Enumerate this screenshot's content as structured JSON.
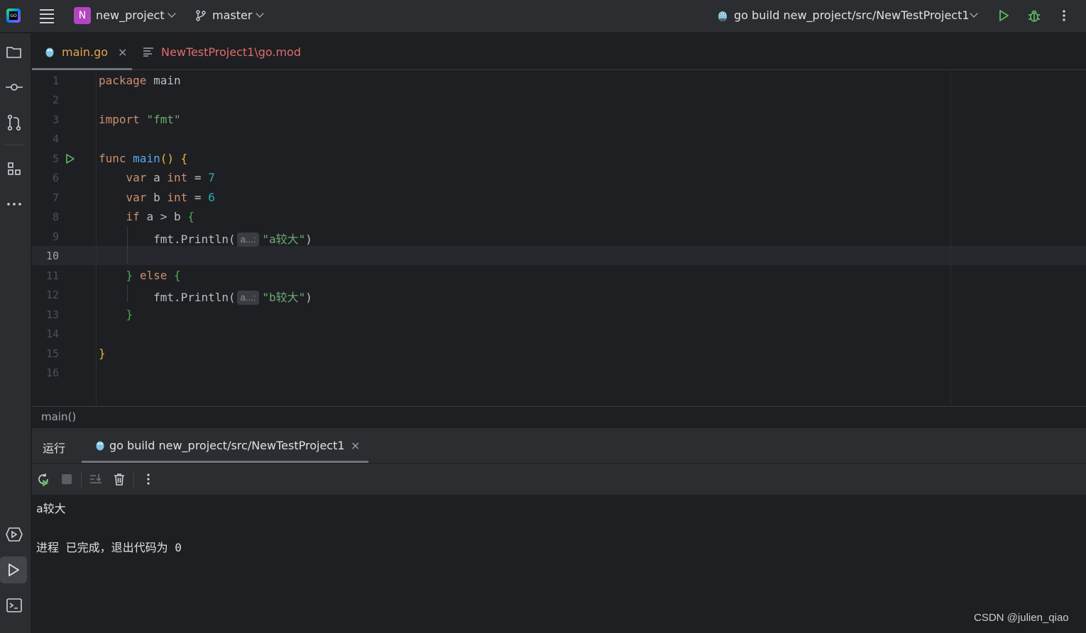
{
  "titlebar": {
    "project_badge": "N",
    "project_name": "new_project",
    "branch": "master",
    "run_config": "go build new_project/src/NewTestProject1"
  },
  "tabs": [
    {
      "label": "main.go",
      "close": "×",
      "active": true
    },
    {
      "label": "NewTestProject1\\go.mod",
      "active": false
    }
  ],
  "editor": {
    "line_numbers": [
      "1",
      "2",
      "3",
      "4",
      "5",
      "6",
      "7",
      "8",
      "9",
      "10",
      "11",
      "12",
      "13",
      "14",
      "15",
      "16"
    ],
    "current_line": "10",
    "tokens": {
      "l1_kw": "package",
      "l1_name": "main",
      "l3_kw": "import",
      "l3_str": "\"fmt\"",
      "l5_kw": "func",
      "l5_fn": "main",
      "l5_parens": "()",
      "l5_brace": "{",
      "l6_kw": "var",
      "l6_name": "a",
      "l6_type": "int",
      "l6_eq": "=",
      "l6_num": "7",
      "l7_kw": "var",
      "l7_name": "b",
      "l7_type": "int",
      "l7_eq": "=",
      "l7_num": "6",
      "l8_kw": "if",
      "l8_cond": "a > b",
      "l8_brace": "{",
      "l9_call": "fmt.Println(",
      "l9_hint": "a...:",
      "l9_str": "\"a较大\"",
      "l9_close": ")",
      "l11_close": "}",
      "l11_kw": "else",
      "l11_brace": "{",
      "l12_call": "fmt.Println(",
      "l12_hint": "a...:",
      "l12_str": "\"b较大\"",
      "l12_close": ")",
      "l13_brace": "}",
      "l15_brace": "}"
    }
  },
  "breadcrumb": "main()",
  "run_panel": {
    "title": "运行",
    "tab_label": "go build new_project/src/NewTestProject1",
    "tab_close": "×",
    "output": [
      "a较大",
      "",
      "进程 已完成，退出代码为 0"
    ]
  },
  "watermark": "CSDN @julien_qiao",
  "colors": {
    "background": "#1e1f22",
    "panel": "#2b2d30",
    "keyword": "#cf8e6d",
    "function": "#56a8f5",
    "string": "#6aab73",
    "number": "#2aacb8",
    "run_green": "#5fb865",
    "project_badge": "#b345c0"
  }
}
